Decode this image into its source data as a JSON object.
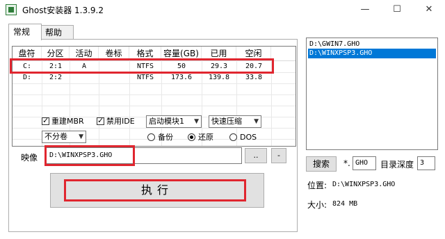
{
  "window": {
    "title": "Ghost安装器 1.3.9.2",
    "minimize": "—",
    "maximize": "☐",
    "close": "✕"
  },
  "tabs": [
    {
      "label": "常规",
      "active": true
    },
    {
      "label": "帮助",
      "active": false
    }
  ],
  "partition_table": {
    "columns": [
      "盘符",
      "分区",
      "活动",
      "卷标",
      "格式",
      "容量(GB)",
      "已用",
      "空闲"
    ],
    "rows": [
      [
        "C:",
        "2:1",
        "A",
        "",
        "NTFS",
        "50",
        "29.3",
        "20.7"
      ],
      [
        "D:",
        "2:2",
        "",
        "",
        "NTFS",
        "173.6",
        "139.8",
        "33.8"
      ]
    ]
  },
  "options": {
    "rebuild_mbr": {
      "label": "重建MBR",
      "checked": true
    },
    "disable_ide": {
      "label": "禁用IDE",
      "checked": true
    },
    "boot_module": "启动模块1",
    "compression": "快速压缩",
    "split": "不分卷",
    "mode": {
      "backup": "备份",
      "restore": "还原",
      "dos": "DOS",
      "selected": "restore"
    }
  },
  "image": {
    "label": "映像",
    "path": "D:\\WINXPSP3.GHO",
    "browse": "..",
    "remove": "-"
  },
  "execute_label": "执      行",
  "file_list": [
    "D:\\GWIN7.GHO",
    "D:\\WINXPSP3.GHO"
  ],
  "file_list_selected": 1,
  "search": {
    "button": "搜索",
    "prefix": "*.",
    "ext": "GHO",
    "depth_label": "目录深度",
    "depth": "3"
  },
  "info": {
    "location_label": "位置:",
    "location": "D:\\WINXPSP3.GHO",
    "size_label": "大小:",
    "size": "824 MB"
  },
  "colors": {
    "highlight": "#e0262f",
    "selection": "#0078d7"
  }
}
